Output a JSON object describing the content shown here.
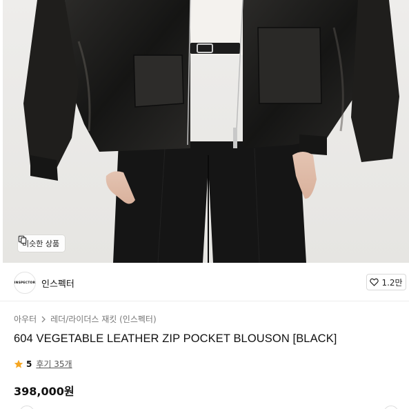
{
  "product_image": {
    "overlay_button_label": "비슷한 상품",
    "icon": "similar-items-icon"
  },
  "brand": {
    "logo_text": "INSPECTOR",
    "name": "인스펙터",
    "like_count": "1.2만",
    "like_icon": "heart-outline-icon"
  },
  "breadcrumb": {
    "items": [
      "아우터",
      "레더/라이더스 재킷 (인스펙터)"
    ],
    "separator_icon": "chevron-right-icon"
  },
  "product": {
    "title": "604 VEGETABLE LEATHER ZIP POCKET BLOUSON [BLACK]",
    "rating_score": "5",
    "review_label": "후기 35개",
    "rating_icon": "star-icon",
    "rating_color": "#f5a623",
    "price": "398,000원"
  }
}
